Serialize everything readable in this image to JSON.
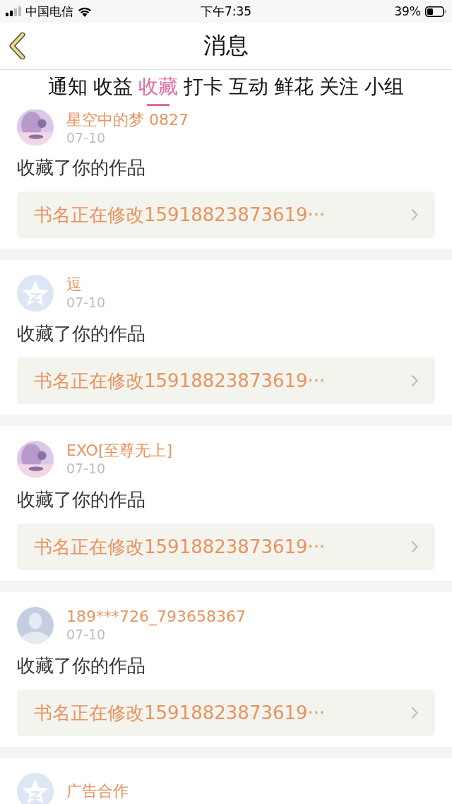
{
  "status_bar": {
    "carrier": "中国电信",
    "time": "下午7:35",
    "battery": "39%"
  },
  "header": {
    "title": "消息"
  },
  "tabs": [
    {
      "label": "通知",
      "selected": false
    },
    {
      "label": "收益",
      "selected": false
    },
    {
      "label": "收藏",
      "selected": true
    },
    {
      "label": "打卡",
      "selected": false
    },
    {
      "label": "互动",
      "selected": false
    },
    {
      "label": "鲜花",
      "selected": false
    },
    {
      "label": "关注",
      "selected": false
    },
    {
      "label": "小组",
      "selected": false
    }
  ],
  "messages": [
    {
      "name": "星空中的梦 0827",
      "date": "07-10",
      "action": "收藏了你的作品",
      "book": "书名正在修改15918823873619···"
    },
    {
      "avatar": {
        "kind": "star"
      },
      "name": "逗",
      "date": "07-10",
      "action": "收藏了你的作品",
      "book": "书名正在修改15918823873619···"
    },
    {
      "name": "EXO[至尊无上]",
      "date": "07-10",
      "action": "收藏了你的作品",
      "book": "书名正在修改15918823873619···"
    },
    {
      "avatar": {
        "kind": "silhouette"
      },
      "name": "189***726_793658367",
      "date": "07-10",
      "action": "收藏了你的作品",
      "book": "书名正在修改15918823873619···"
    },
    {
      "avatar": {
        "kind": "star"
      },
      "name": "广告合作"
    }
  ]
}
